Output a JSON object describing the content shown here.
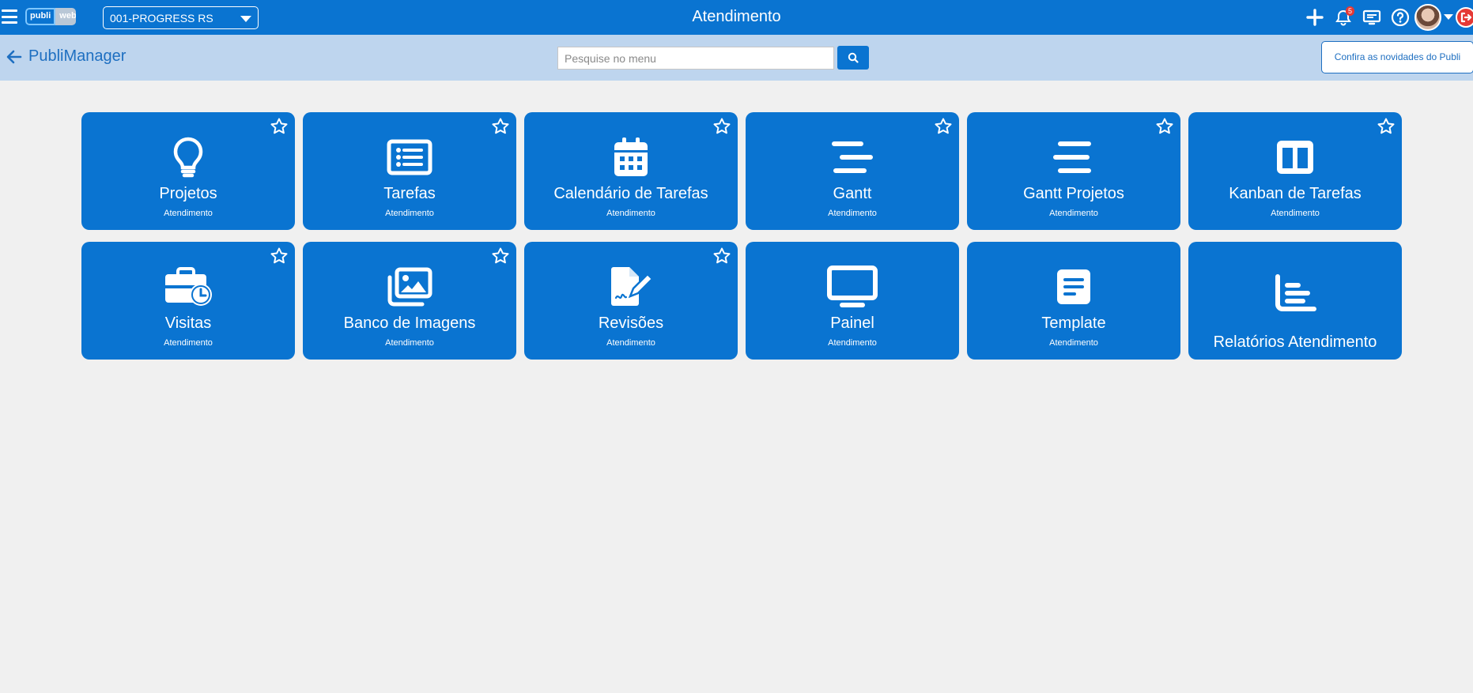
{
  "header": {
    "title": "Atendimento",
    "logo": {
      "left": "publi",
      "right": "web"
    },
    "company": "001-PROGRESS RS",
    "notifications_count": "5",
    "icons": [
      "menu-icon",
      "plus-icon",
      "bell-icon",
      "monitor-icon",
      "help-icon",
      "avatar",
      "chevron-down-icon",
      "logout-icon"
    ]
  },
  "subheader": {
    "back_label": "PubliManager",
    "search_placeholder": "Pesquise no menu",
    "news_button": "Confira as novidades do Publi"
  },
  "tiles": [
    {
      "title": "Projetos",
      "subtitle": "Atendimento",
      "icon": "lightbulb-icon",
      "favorite": true
    },
    {
      "title": "Tarefas",
      "subtitle": "Atendimento",
      "icon": "list-icon",
      "favorite": true
    },
    {
      "title": "Calendário de Tarefas",
      "subtitle": "Atendimento",
      "icon": "calendar-icon",
      "favorite": true
    },
    {
      "title": "Gantt",
      "subtitle": "Atendimento",
      "icon": "gantt-icon",
      "favorite": true
    },
    {
      "title": "Gantt Projetos",
      "subtitle": "Atendimento",
      "icon": "gantt-icon",
      "favorite": true
    },
    {
      "title": "Kanban de Tarefas",
      "subtitle": "Atendimento",
      "icon": "kanban-icon",
      "favorite": true
    },
    {
      "title": "Visitas",
      "subtitle": "Atendimento",
      "icon": "briefcase-clock-icon",
      "favorite": true
    },
    {
      "title": "Banco de Imagens",
      "subtitle": "Atendimento",
      "icon": "images-icon",
      "favorite": true
    },
    {
      "title": "Revisões",
      "subtitle": "Atendimento",
      "icon": "file-signature-icon",
      "favorite": true
    },
    {
      "title": "Painel",
      "subtitle": "Atendimento",
      "icon": "monitor-icon",
      "favorite": false
    },
    {
      "title": "Template",
      "subtitle": "Atendimento",
      "icon": "template-icon",
      "favorite": false
    },
    {
      "title": "Relatórios Atendimento",
      "subtitle": "",
      "icon": "bar-chart-icon",
      "favorite": false
    }
  ]
}
